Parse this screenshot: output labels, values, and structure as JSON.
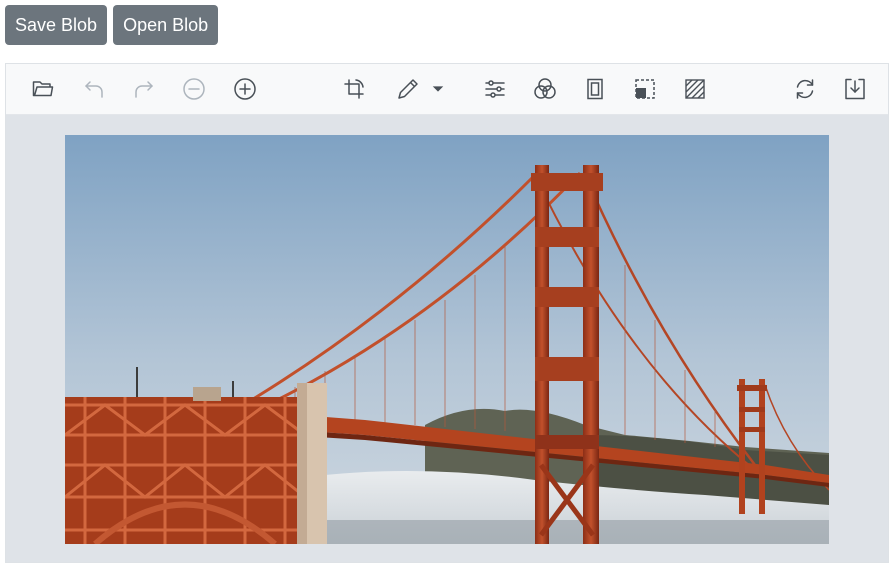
{
  "top_buttons": {
    "save_label": "Save Blob",
    "open_label": "Open Blob"
  },
  "toolbar": {
    "tools": [
      {
        "name": "open-icon"
      },
      {
        "name": "undo-icon"
      },
      {
        "name": "redo-icon"
      },
      {
        "name": "zoom-out-icon"
      },
      {
        "name": "zoom-in-icon"
      },
      {
        "name": "crop-icon"
      },
      {
        "name": "annotate-pen-icon"
      },
      {
        "name": "dropdown-caret-icon"
      },
      {
        "name": "adjust-sliders-icon"
      },
      {
        "name": "filters-icon"
      },
      {
        "name": "frame-icon"
      },
      {
        "name": "redact-icon"
      },
      {
        "name": "fill-pattern-icon"
      },
      {
        "name": "reset-icon"
      },
      {
        "name": "save-download-icon"
      }
    ]
  },
  "colors": {
    "button_bg": "#6c757d",
    "toolbar_bg": "#f8f9fa",
    "canvas_bg": "#dfe3e8",
    "icon_active": "#495057",
    "icon_disabled": "#adb5bd"
  }
}
